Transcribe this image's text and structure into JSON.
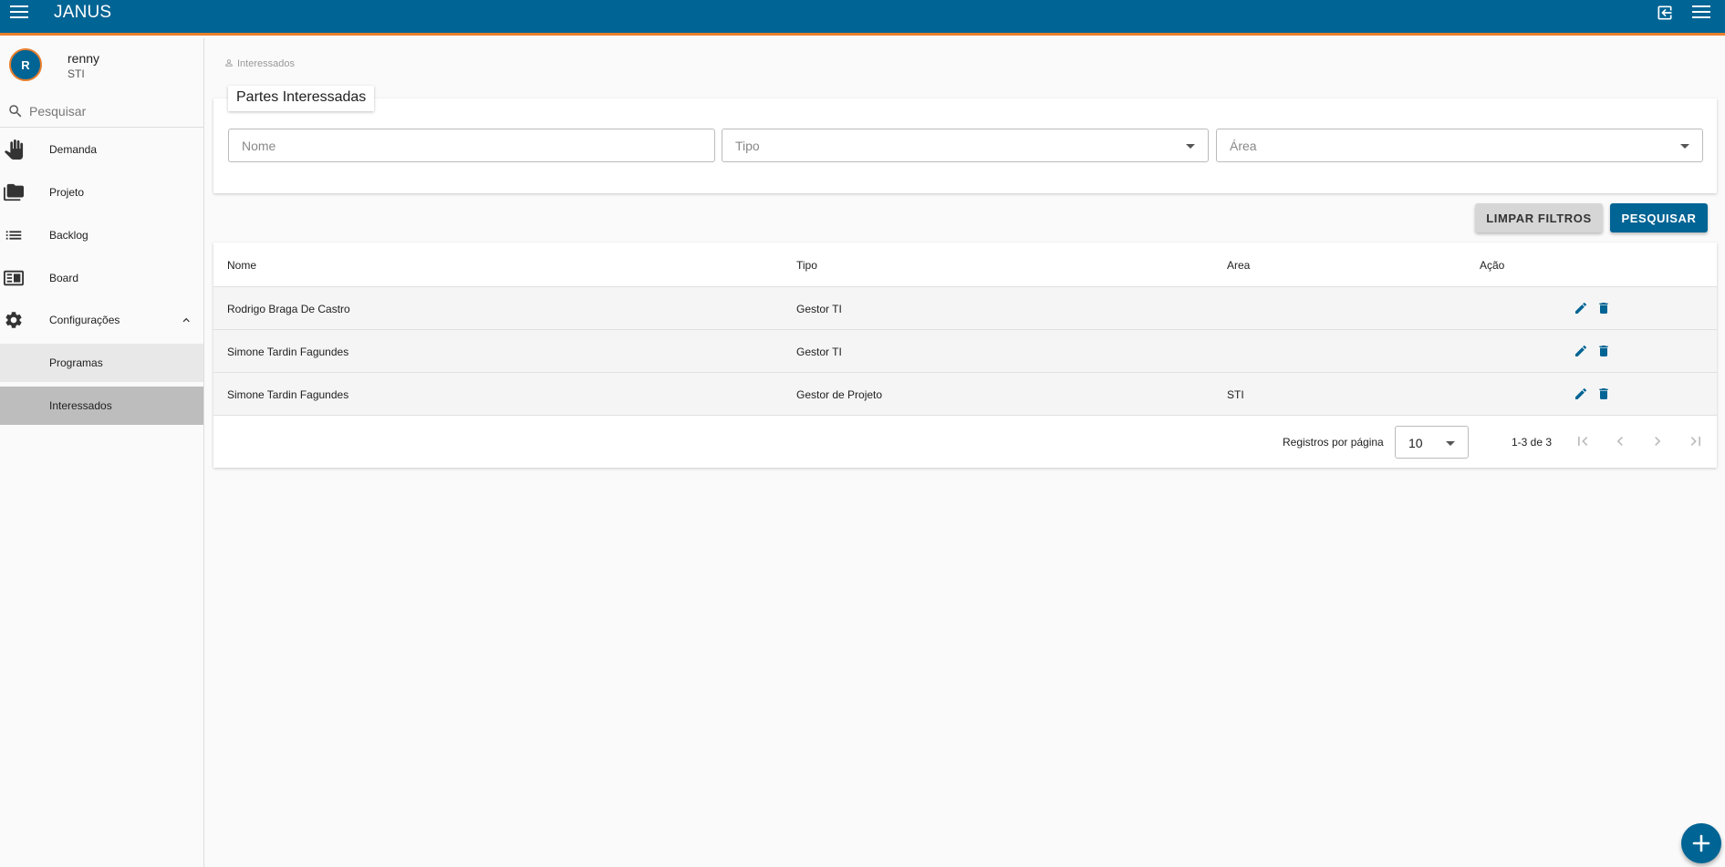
{
  "app": {
    "title": "JANUS"
  },
  "user": {
    "initial": "R",
    "name": "renny",
    "department": "STI"
  },
  "search": {
    "placeholder": "Pesquisar"
  },
  "nav": {
    "demanda": "Demanda",
    "projeto": "Projeto",
    "backlog": "Backlog",
    "board": "Board",
    "configuracoes": "Configurações",
    "programas": "Programas",
    "interessados": "Interessados"
  },
  "breadcrumb": "Interessados",
  "filters": {
    "title": "Partes Interessadas",
    "nome_placeholder": "Nome",
    "tipo_placeholder": "Tipo",
    "area_placeholder": "Área",
    "clear_label": "LIMPAR FILTROS",
    "search_label": "PESQUISAR"
  },
  "table": {
    "headers": {
      "nome": "Nome",
      "tipo": "Tipo",
      "area": "Area",
      "acao": "Ação"
    },
    "rows": [
      {
        "nome": "Rodrigo Braga De Castro",
        "tipo": "Gestor TI",
        "area": ""
      },
      {
        "nome": "Simone Tardin Fagundes",
        "tipo": "Gestor TI",
        "area": ""
      },
      {
        "nome": "Simone Tardin Fagundes",
        "tipo": "Gestor de Projeto",
        "area": "STI"
      }
    ]
  },
  "pagination": {
    "label": "Registros por página",
    "per_page": "10",
    "range": "1-3 de 3"
  },
  "icons": {
    "menu": "menu-icon",
    "logout": "logout-icon",
    "search": "search-icon",
    "demanda": "hand-icon",
    "projeto": "folder-icon",
    "backlog": "list-icon",
    "board": "board-icon",
    "configuracoes": "gear-icon",
    "edit": "pencil-icon",
    "delete": "trash-icon",
    "add": "plus-icon"
  },
  "colors": {
    "primary": "#006494",
    "accent": "#e87e2c",
    "active_item": "#bdbdbd"
  }
}
